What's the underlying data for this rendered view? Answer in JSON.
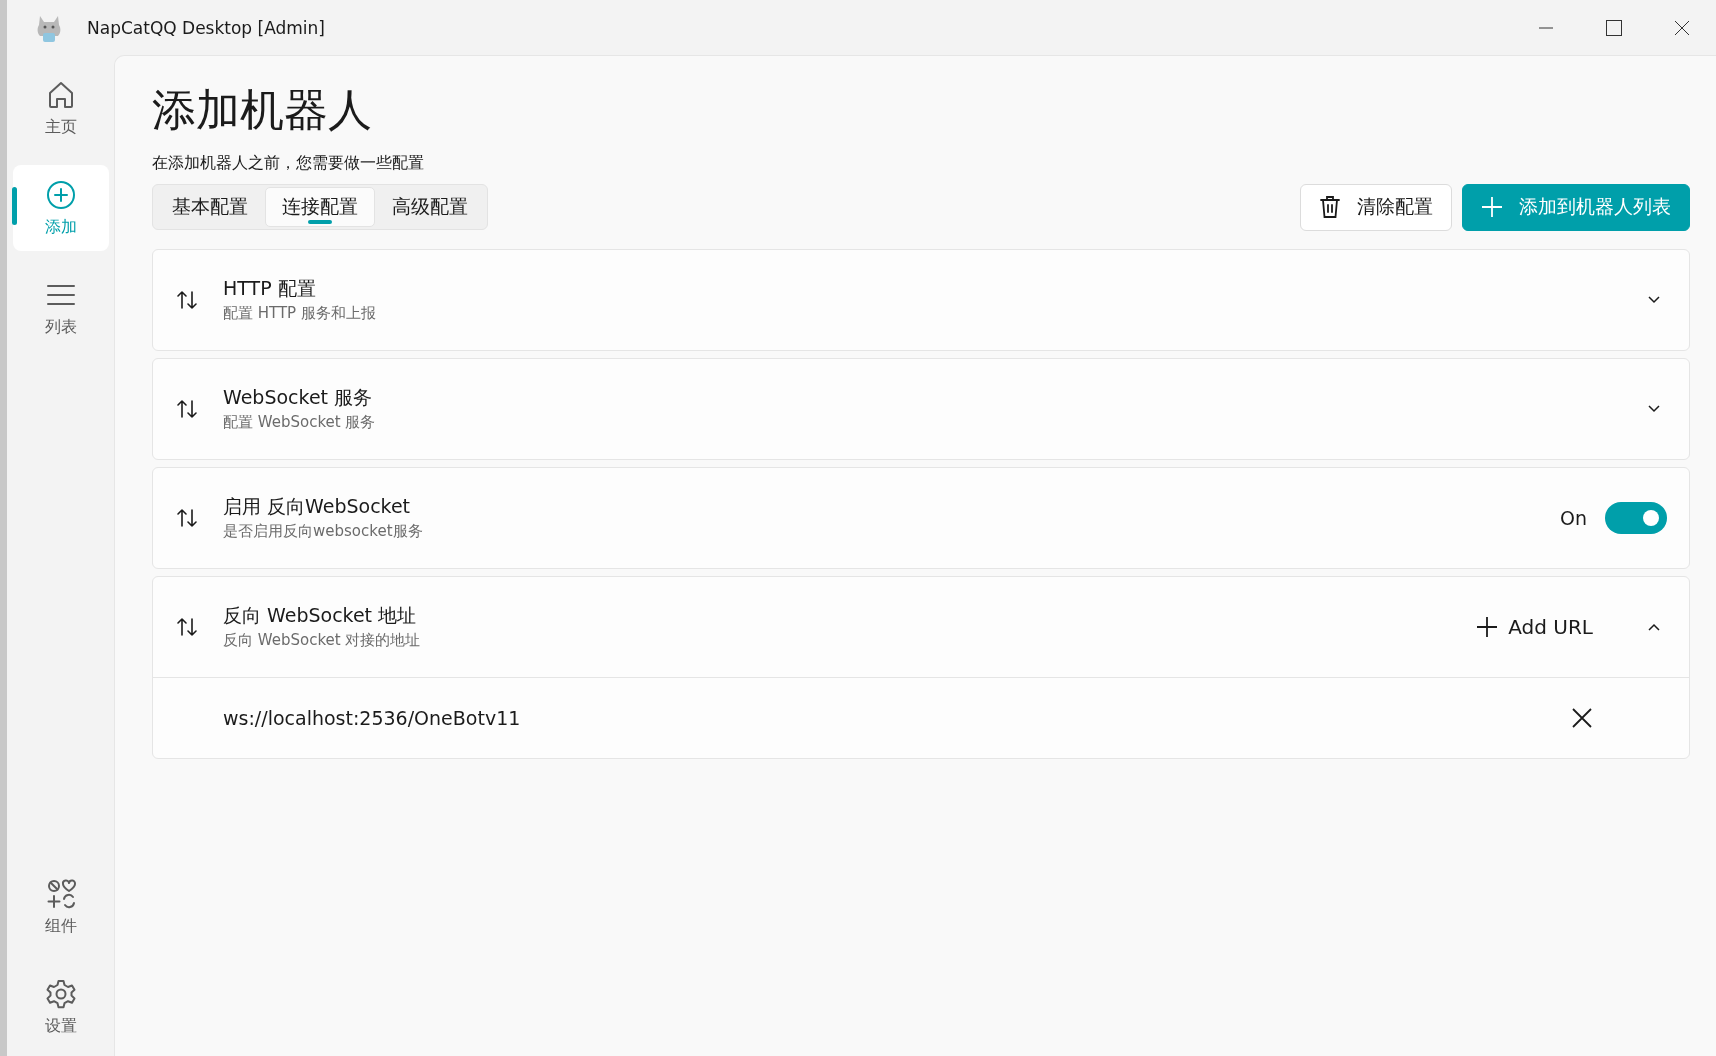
{
  "window": {
    "title": "NapCatQQ Desktop [Admin]"
  },
  "sidebar": {
    "items": [
      {
        "label": "主页",
        "selected": false
      },
      {
        "label": "添加",
        "selected": true
      },
      {
        "label": "列表",
        "selected": false
      }
    ],
    "bottom_items": [
      {
        "label": "组件",
        "selected": false
      },
      {
        "label": "设置",
        "selected": false
      }
    ]
  },
  "page": {
    "title": "添加机器人",
    "subtitle": "在添加机器人之前，您需要做一些配置"
  },
  "tabs": [
    {
      "label": "基本配置",
      "selected": false
    },
    {
      "label": "连接配置",
      "selected": true
    },
    {
      "label": "高级配置",
      "selected": false
    }
  ],
  "buttons": [
    {
      "kind": "clear",
      "label": "清除配置"
    },
    {
      "kind": "primary",
      "label": "添加到机器人列表"
    }
  ],
  "cards": [
    {
      "kind": "expander",
      "title": "HTTP 配置",
      "description": "配置 HTTP 服务和上报",
      "expanded": false
    },
    {
      "kind": "expander",
      "title": "WebSocket 服务",
      "description": "配置 WebSocket 服务",
      "expanded": false
    },
    {
      "kind": "toggle",
      "title": "启用 反向WebSocket",
      "description": "是否启用反向websocket服务",
      "on": true,
      "state_label": "On"
    },
    {
      "kind": "url_list",
      "title": "反向 WebSocket 地址",
      "description": "反向 WebSocket 对接的地址",
      "expanded": true,
      "add_label": "Add URL",
      "urls": [
        "ws://localhost:2536/OneBotv11"
      ]
    }
  ]
}
